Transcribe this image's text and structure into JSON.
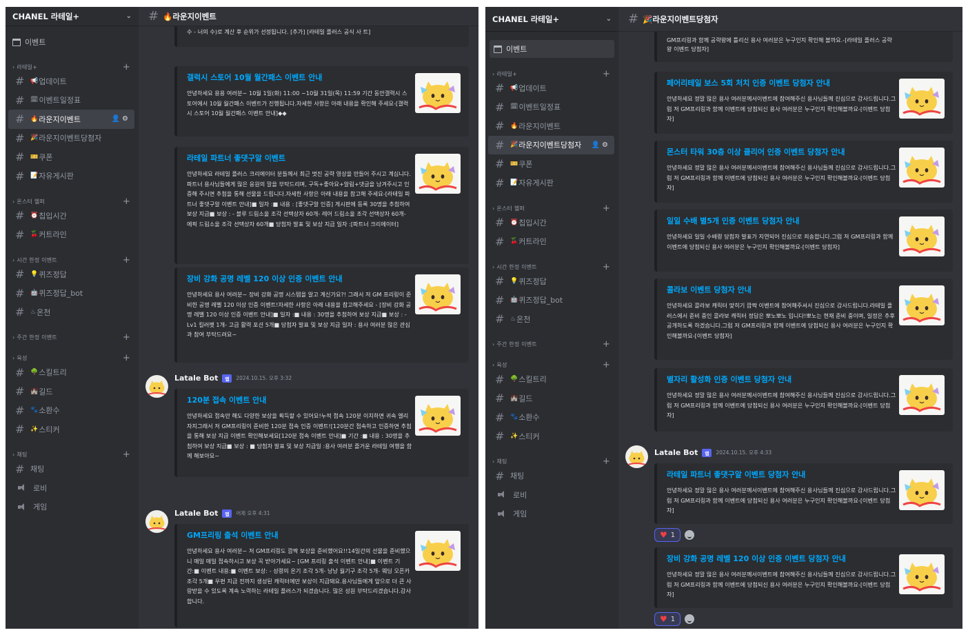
{
  "left": {
    "server": {
      "name": "CHANEL 라테일+"
    },
    "events_label": "이벤트",
    "channel_title": "🔥라운지이벤트",
    "categories": [
      {
        "name": "라테일+",
        "channels": [
          {
            "icon": "hash",
            "emoji": "📢",
            "label": "업데이트"
          },
          {
            "icon": "hash",
            "emoji": "🗓",
            "label": "이벤트일정표"
          },
          {
            "icon": "hash",
            "emoji": "🔥",
            "label": "라운지이벤트",
            "active": true
          },
          {
            "icon": "hash",
            "emoji": "🎉",
            "label": "라운지이벤트당첨자"
          },
          {
            "icon": "hash",
            "emoji": "🎫",
            "label": "쿠폰"
          },
          {
            "icon": "hash",
            "emoji": "📝",
            "label": "자유게시판"
          }
        ]
      },
      {
        "name": "온스터 헬퍼",
        "channels": [
          {
            "icon": "hash",
            "emoji": "⏰",
            "label": "칩입시간"
          },
          {
            "icon": "hash",
            "emoji": "🍒",
            "label": "커트라인"
          }
        ]
      },
      {
        "name": "시간 한정 이벤트",
        "channels": [
          {
            "icon": "hash",
            "emoji": "💡",
            "label": "퀴즈정답"
          },
          {
            "icon": "hash",
            "emoji": "🤖",
            "label": "퀴즈정답_bot"
          },
          {
            "icon": "hash",
            "emoji": "♨",
            "label": "온천"
          }
        ]
      },
      {
        "name": "주간 한정 이벤트",
        "channels": []
      },
      {
        "name": "육성",
        "channels": [
          {
            "icon": "hash",
            "emoji": "🌳",
            "label": "스킬트리"
          },
          {
            "icon": "hash",
            "emoji": "🏰",
            "label": "길드"
          },
          {
            "icon": "hash",
            "emoji": "🐾",
            "label": "소환수"
          },
          {
            "icon": "hash",
            "emoji": "✨",
            "label": "스티커"
          }
        ]
      },
      {
        "name": "채팅",
        "channels": [
          {
            "icon": "hash",
            "emoji": "",
            "label": "채팅"
          },
          {
            "icon": "voice",
            "emoji": "",
            "label": "로비"
          },
          {
            "icon": "voice",
            "emoji": "",
            "label": "게임"
          }
        ]
      }
    ],
    "top_cut_text": "수 - 너의 수)로 계산 후 순위가 선정됩니다. [추가] [라테일 플러스 공식 사 트]",
    "embeds": [
      {
        "title": "갤럭시 스토어 10월 월간패스 이벤트 안내",
        "body": "안녕하세요 용용 여러분~ 10월 1일(화) 11:00 ~10월 31일(목) 11:59 기간 동안갤럭시 스토어에서 10월 월간패스 이벤트가 진행됩니다.자세한 사항은 아래 내용을 확인해 주세요-[갤럭시 스토어 10월 월간패스 이벤트 안내]◆◆"
      },
      {
        "title": "라테일 파트너 좋댓구알 이벤트",
        "body": "안녕하세요 라테일 플러스 크리에이터 분들께서 최근 멋진 공략 영상을 만들어 주시고 계십니다.파트너 용사님들에게 많은 응원의 말을 부탁드리며, 구독+좋아요+알림+댓글을 남겨주시고 인증해 주시면 추첨을 통해 선물을 드립니다.자세한 사항은 아래 내용을 참고해 주세요-[라테일 파트너 좋댓구알 이벤트 안내]■ 일자 :■ 내용 : [좋댓구알 인증] 게시판에 등록 30명을 추첨하여 보상 지급■ 보상 : - 블루 드림소울 조각 선택상자 60개- 레어 드림소울 조각 선택상자 60개- 에픽 드림소울 조각 선택상자 60개■ 당첨자 발표 및 보상 지급 일자 :[파트너 크리에이터]"
      },
      {
        "title": "장비 강화 공명 레벨 120 이상 인증 이벤트 안내",
        "body": "안녕하세요 용사 여러분~ 장비 강화 공명 시스템을 알고 계신가요?! 그래서 저 GM 프리링이 준비한 공명 레벨 120 이상 인증 이벤트!자세한 사항은 아래 내용을 참고해주세요 - [장비 강화 공명 레벨 120 이상 인증 이벤트 안내]■ 일자 :■ 내용 : 30명을 추첨하여 보상 지급■ 보상 : - Lv1 킬러펫 1개- 고급 활력 포션 5개■ 당첨자 발표 및 보상 지급 일자 : 용사 여러분 많은 관심과 참여 부탁드려요~"
      }
    ],
    "messages": [
      {
        "author": "Latale Bot",
        "badge": "앱",
        "time": "2024.10.15. 오후 3:32",
        "embed": {
          "title": "120분 접속 이벤트 안내",
          "body": "안녕하세요 접속만 해도 다양한 보상을 획득할 수 있어요!누적 접속 120분 이치하면 귀속 엘리자지그래서 저 GM프리링이 준비한 120분 접속 인증 이벤트![120분간 접속하고 인증하면 추첨을 통해 보상 지급 이벤트 확인해보세요[120분 접속 이벤트 안내]■ 기간 :■ 내용 : 30명을 추첨하여 보상 지급■ 보상 : ■ 당첨자 발표 및 보상 지급일 :용사 여러분 즐거운 라테일 여행을 함께 해보아요~"
        }
      },
      {
        "author": "Latale Bot",
        "badge": "앱",
        "time": "어제 오후 4:31",
        "embed": {
          "title": "GM프리링 출석 이벤트 안내",
          "body": "안녕하세요 용사 여러분~ 저 GM프리링도 깜짝 보상을 준비했어요!!14일간의 선물을 준비했으니 매일 매일 접속하시고 보상 꼭 받아가세요~ [GM 프리링 출석 이벤트 안내]■ 이벤트 기간:■ 이벤트 내용:■ 이벤트 보상: - 성령의 온기 조각 5개- 낭낭 월기구 조각 5개- 웨딩 오픈카 조각 5개■ 우편 지급 전까지 생성된 캐릭터에만 보상이 지급돼요.용사님들에게 앞으로 더 큰 사랑받을 수 있도록 계속 노력하는 라테일 플러스가 되겠습니다. 많은 성원 부탁드리겠습니다.감사합니다."
        }
      }
    ]
  },
  "right": {
    "server": {
      "name": "CHANEL 라테일+"
    },
    "events_label": "이벤트",
    "channel_title": "🎉라운지이벤트당첨자",
    "categories": [
      {
        "name": "라테일+",
        "channels": [
          {
            "icon": "hash",
            "emoji": "📢",
            "label": "업데이트"
          },
          {
            "icon": "hash",
            "emoji": "🗓",
            "label": "이벤트일정표"
          },
          {
            "icon": "hash",
            "emoji": "🔥",
            "label": "라운지이벤트"
          },
          {
            "icon": "hash",
            "emoji": "🎉",
            "label": "라운지이벤트당첨자",
            "active": true
          },
          {
            "icon": "hash",
            "emoji": "🎫",
            "label": "쿠폰"
          },
          {
            "icon": "hash",
            "emoji": "📝",
            "label": "자유게시판"
          }
        ]
      },
      {
        "name": "온스터 헬퍼",
        "channels": [
          {
            "icon": "hash",
            "emoji": "⏰",
            "label": "칩입시간"
          },
          {
            "icon": "hash",
            "emoji": "🍒",
            "label": "커트라인"
          }
        ]
      },
      {
        "name": "시간 한정 이벤트",
        "channels": [
          {
            "icon": "hash",
            "emoji": "💡",
            "label": "퀴즈정답"
          },
          {
            "icon": "hash",
            "emoji": "🤖",
            "label": "퀴즈정답_bot"
          },
          {
            "icon": "hash",
            "emoji": "♨",
            "label": "온천"
          }
        ]
      },
      {
        "name": "주간 한정 이벤트",
        "channels": []
      },
      {
        "name": "육성",
        "channels": [
          {
            "icon": "hash",
            "emoji": "🌳",
            "label": "스킬트리"
          },
          {
            "icon": "hash",
            "emoji": "🏰",
            "label": "길드"
          },
          {
            "icon": "hash",
            "emoji": "🐾",
            "label": "소환수"
          },
          {
            "icon": "hash",
            "emoji": "✨",
            "label": "스티커"
          }
        ]
      },
      {
        "name": "채팅",
        "channels": [
          {
            "icon": "hash",
            "emoji": "",
            "label": "채팅"
          },
          {
            "icon": "voice",
            "emoji": "",
            "label": "로비"
          },
          {
            "icon": "voice",
            "emoji": "",
            "label": "게임"
          }
        ]
      }
    ],
    "top_cut_text": "GM프리링과 함께 공략왕에 틀리신 용사 여러분은 누구인지 확인해 볼까요.-[라테일 플러스 공략왕 이벤트 당첨자]",
    "embeds": [
      {
        "title": "페어리테일 보스 5회 처치 인증 이벤트 당첨자 안내",
        "body": "안녕하세요 정말 많은 용사 여러분께서이벤트에 참여해주신 용사님들께 진심으로 감사드립니다.그럼 저 GM프리링과 함께 이벤트에 당첨되신 용사 여러분은 누구인지 확인해볼까요-[이벤트 당첨자]"
      },
      {
        "title": "몬스터 타워 30층 이상 클리어 인증 이벤트 당첨자 안내",
        "body": "안녕하세요 정말 많은 용사 여러분께서이벤트에 참여해주신 용사님들께 진심으로 감사드립니다.그럼 저 GM프리링과 함께 이벤트에 당첨되신 용사 여러분은 누구인지 확인해볼까요-[이벤트 당첨자]"
      },
      {
        "title": "일일 수배 별5개 인증 이벤트 당첨자 안내",
        "body": "안녕하세요 일일 수배령 당첨자 발표가 지연되어 진심으로 죄송합니다.그럼 저 GM프리링과 함께 이벤트에 당첨되신 용사 여러분은 누구인지 확인해볼까요-[이벤트 당첨자]"
      },
      {
        "title": "콜라보 이벤트 당첨자 안내",
        "body": "안녕하세요 콜라보 캐릭터 맞히기 깜짝 이벤트에 참여해주셔서 진심으로 감사드립니다.라테일 플러스에서 준비 중인 콜라보 캐릭터 정답은 뽀노뽀노 입니다!뽀노는 현재 준비 중이며, 일정은 추후 공개하도록 하겠습니다.그럼 저 GM프리링과 함께 이벤트에 당첨되신 용사 여러분은 누구인지 확인해볼까요-[이벤트 당첨자]"
      },
      {
        "title": "별자리 활성화 인증 이벤트 당첨자 안내",
        "body": "안녕하세요 정말 많은 용사 여러분께서이벤트에 참여해주신 용사님들께 진심으로 감사드립니다.그럼 저 GM프리링과 함께 이벤트에 당첨되신 용사 여러분은 누구인지 확인해볼까요-[이벤트 당첨자]"
      }
    ],
    "message": {
      "author": "Latale Bot",
      "badge": "앱",
      "time": "2024.10.15. 오후 4:33"
    },
    "msg_embeds": [
      {
        "title": "라테일 파트너 좋댓구알 이벤트 당첨자 안내",
        "body": "안녕하세요 정말 많은 용사 여러분께서이벤트에 참여해주신 용사님들께 진심으로 감사드립니다.그럼 저 GM프리링과 함께 이벤트에 당첨되신 용사 여러분은 누구인지 확인해볼까요-[이벤트 당첨자]",
        "reaction": {
          "emoji": "heart",
          "count": "1"
        }
      },
      {
        "title": "장비 강화 공명 레벨 120 이상 인증 이벤트 당첨자 안내",
        "body": "안녕하세요 정말 많은 용사 여러분께서이벤트에 참여해주신 용사님들께 진심으로 감사드립니다.그럼 저 GM프리링과 함께 이벤트에 당첨되신 용사 여러분은 누구인지 확인해볼까요-[이벤트 당첨자]",
        "reaction": {
          "emoji": "heart",
          "count": "1"
        }
      }
    ]
  }
}
